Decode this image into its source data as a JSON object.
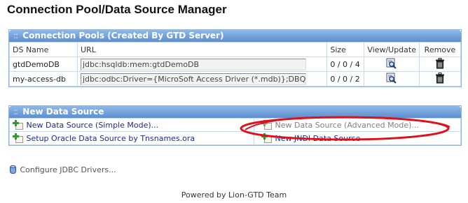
{
  "page": {
    "title": "Connection Pool/Data Source Manager"
  },
  "pools": {
    "header": "Connection Pools (Created By GTD Server)",
    "columns": {
      "name": "DS Name",
      "url": "URL",
      "size": "Size",
      "view": "View/Update",
      "remove": "Remove"
    },
    "rows": [
      {
        "name": "gtdDemoDB",
        "url": "jdbc:hsqldb:mem:gtdDemoDB",
        "size": "0 / 0 / 4"
      },
      {
        "name": "my-access-db",
        "url": "jdbc:odbc:Driver={MicroSoft Access Driver (*.mdb)};DBQ=",
        "size": "0 / 0 / 2"
      }
    ]
  },
  "new_ds": {
    "header": "New Data Source",
    "simple": "New Data Source (Simple Mode)...",
    "advanced": "New Data Source (Advanced Mode)...",
    "oracle": "Setup Oracle Data Source by Tnsnames.ora",
    "jndi": "New JNDI Data Source"
  },
  "jdbc": {
    "label": "Configure JDBC Drivers..."
  },
  "footer": {
    "text": "Powered by Lion-GTD Team"
  },
  "icons": {
    "header_dots": "dots-icon",
    "view": "magnifier-icon",
    "remove": "trash-icon",
    "add": "add-document-icon",
    "jdbc": "database-icon"
  },
  "colors": {
    "header_bg": "#6f9fdb",
    "link": "#1a2c8a",
    "disabled_link": "#808080",
    "annotation": "#e0101a"
  }
}
